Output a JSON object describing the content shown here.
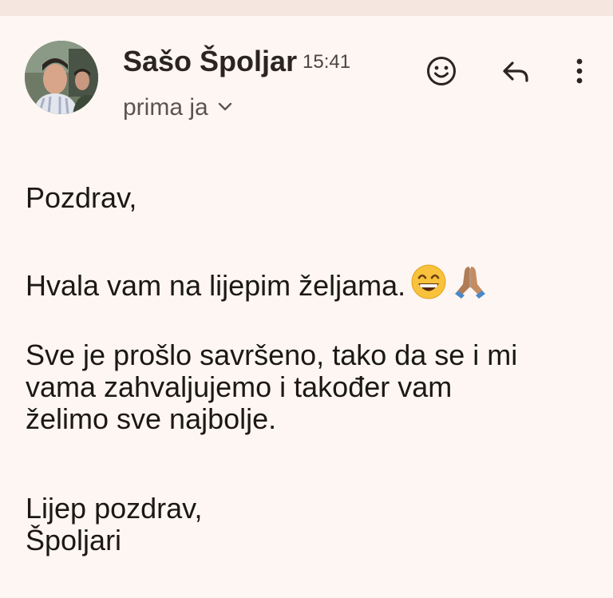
{
  "header": {
    "sender_name": "Sašo Špoljar",
    "time": "15:41",
    "recipient": "prima ja",
    "avatar": "avatar",
    "icons": {
      "react": "smile-icon",
      "reply": "reply-icon",
      "more": "more-vert-icon",
      "chevron": "chevron-down-icon"
    }
  },
  "message": {
    "greeting": "Pozdrav,",
    "line_thanks": "Hvala vam na lijepim željama.",
    "emojis": [
      "grinning-face-emoji",
      "folded-hands-emoji"
    ],
    "para_3_line_1": "Sve je prošlo savršeno, tako da se i mi",
    "para_3_line_2": "vama zahvaljujemo i također vam",
    "para_3_line_3": "želimo sve najbolje.",
    "closing": "Lijep pozdrav,",
    "signature": "Špoljari"
  },
  "colors": {
    "background": "#fdf6f2",
    "top_band": "#f5e6df",
    "text": "#1b1816",
    "muted": "#5a5350"
  }
}
